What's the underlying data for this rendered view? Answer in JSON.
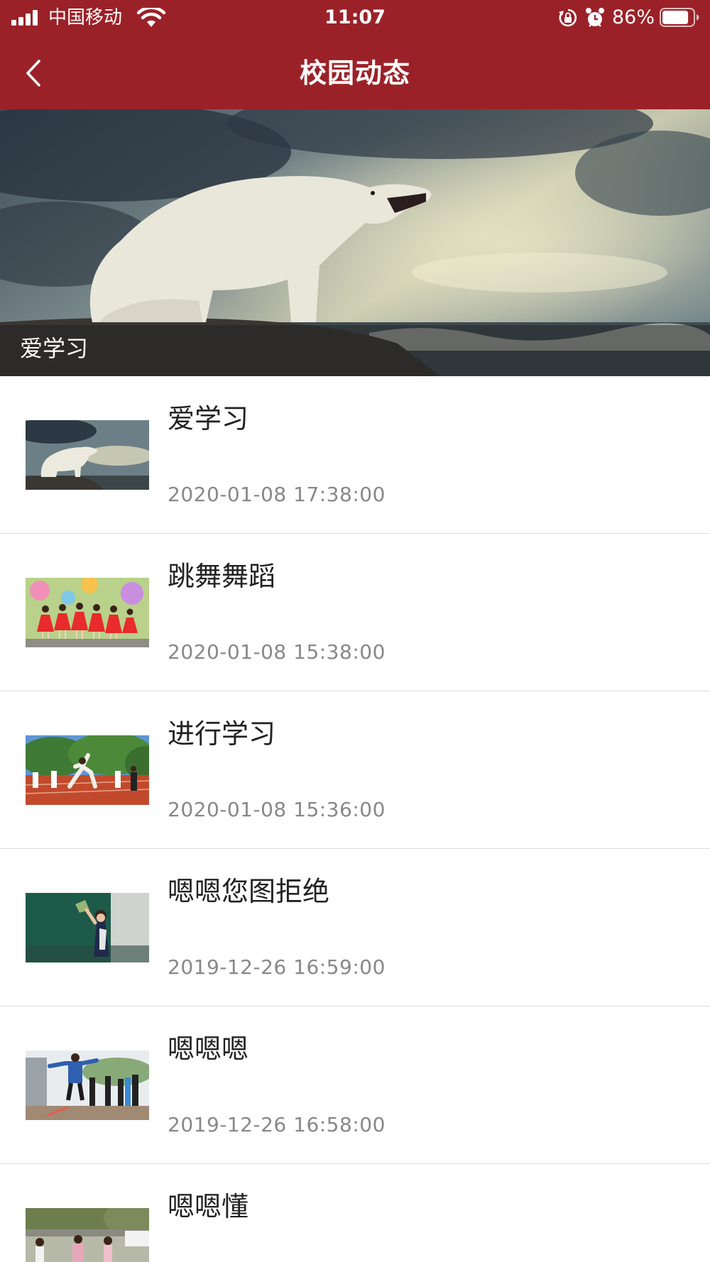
{
  "status_bar": {
    "carrier": "中国移动",
    "time": "11:07",
    "battery_percent": "86%",
    "battery_level": 0.86,
    "icons": [
      "signal-icon",
      "wifi-icon",
      "orientation-lock-icon",
      "alarm-icon",
      "battery-icon"
    ]
  },
  "nav": {
    "title": "校园动态",
    "back_icon": "chevron-left-icon"
  },
  "banner": {
    "caption": "爱学习"
  },
  "news": [
    {
      "title": "爱学习",
      "date": "2020-01-08 17:38:00"
    },
    {
      "title": "跳舞舞蹈",
      "date": "2020-01-08 15:38:00"
    },
    {
      "title": "进行学习",
      "date": "2020-01-08 15:36:00"
    },
    {
      "title": "嗯嗯您图拒绝",
      "date": "2019-12-26 16:59:00"
    },
    {
      "title": "嗯嗯嗯",
      "date": "2019-12-26 16:58:00"
    },
    {
      "title": "嗯嗯懂",
      "date": ""
    }
  ],
  "colors": {
    "header_bg": "#9b2128",
    "title_text": "#222222",
    "date_text": "#888888",
    "divider": "#dcdcdc"
  }
}
